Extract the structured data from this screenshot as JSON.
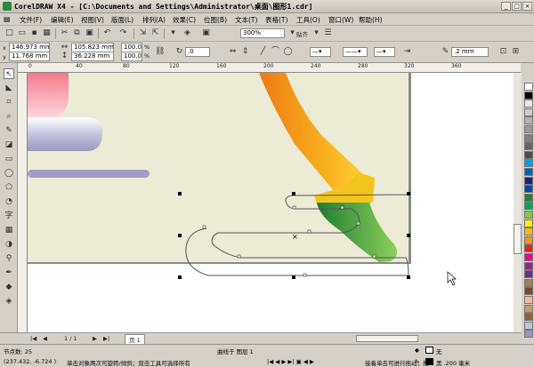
{
  "window": {
    "title": "CorelDRAW X4 - [C:\\Documents and Settings\\Administrator\\桌面\\图形1.cdr]",
    "minimize": "_",
    "restore": "□",
    "close": "×"
  },
  "menu": {
    "items": [
      "文件(F)",
      "编辑(E)",
      "视图(V)",
      "版面(L)",
      "排列(A)",
      "效果(C)",
      "位图(B)",
      "文本(T)",
      "表格(T)",
      "工具(O)",
      "窗口(W)",
      "帮助(H)"
    ]
  },
  "toolbar": {
    "zoom_value": "300%",
    "snap_label": "贴齐"
  },
  "properties": {
    "x_label": "x",
    "x_value": "146.973 mm",
    "y_label": "y",
    "y_value": "11.768 mm",
    "w_value": "105.823 mm",
    "h_value": "36.228 mm",
    "scale_x": "100.0",
    "scale_y": "100.0",
    "percent": "%",
    "angle": ".0",
    "outline_width": ".2 mm"
  },
  "rulers": {
    "h_ticks": [
      "0",
      "40",
      "80",
      "120",
      "160",
      "200",
      "240",
      "280",
      "320",
      "360"
    ],
    "h_ticks_visible": [
      "0",
      "40",
      "80",
      "120",
      "160",
      "200",
      "240",
      "280",
      "320",
      "360"
    ]
  },
  "bottom": {
    "page_count": "1 / 1",
    "page_tab": "页 1"
  },
  "status": {
    "nodes": "节点数: 25",
    "layer": "曲线于 图层 1",
    "coords": "(237.432, -6.724 )",
    "hint": "单击对象两次可旋转/倾斜；双击工具可选择所有",
    "fill_label": "无",
    "fill_hint": "接着单击可进行拖动；按...",
    "outline_label": "黑  .200 毫米"
  },
  "palette": {
    "colors": [
      "#ffffff",
      "#000000",
      "#e6e6e6",
      "#cccccc",
      "#b3b3b3",
      "#999999",
      "#808080",
      "#666666",
      "#4d4d4d",
      "#00a0e9",
      "#0066b3",
      "#1a237e",
      "#0047ab",
      "#2e7d32",
      "#00a651",
      "#8dc63f",
      "#fff200",
      "#fdb913",
      "#f7941d",
      "#ed1c24",
      "#ec008c",
      "#92278f",
      "#662d91",
      "#a67c52",
      "#754c24",
      "#f9b5a0",
      "#c69c6d",
      "#8c6239",
      "#b8c7d9",
      "#9d8fc4"
    ]
  }
}
